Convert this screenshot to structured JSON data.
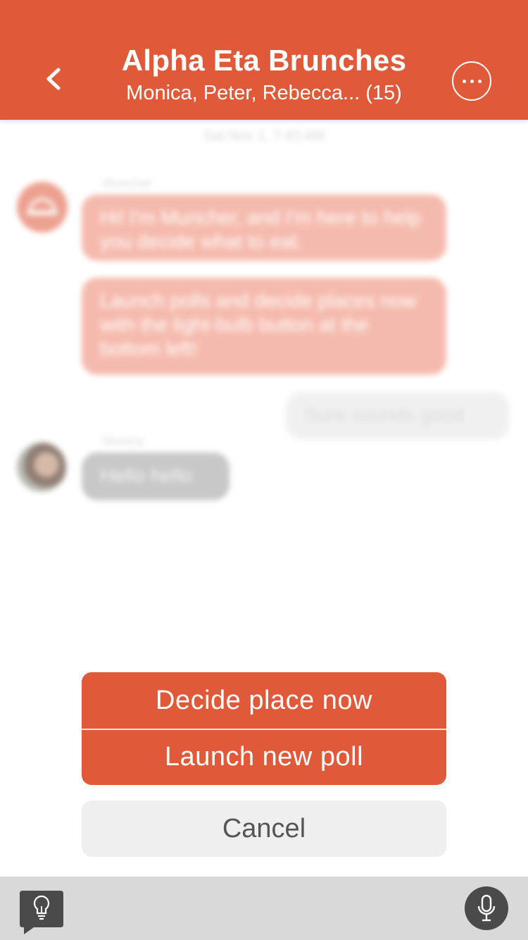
{
  "header": {
    "title": "Alpha Eta Brunches",
    "subtitle": "Monica, Peter, Rebecca... (15)",
    "back_icon": "chevron-left-icon",
    "more_icon": "more-options-icon",
    "color": "#e05a3a"
  },
  "chat": {
    "timestamp": "Sat Nov 1, 7:43 AM",
    "bot_sender": "Muncher",
    "bot_messages": [
      "Hi! I'm Muncher, and I'm here to help you decide what to eat.",
      "Launch polls and decide places now with the light-bulb button at the bottom left!"
    ],
    "my_message": "Sure sounds good",
    "user_sender": "Monica",
    "user_message": "Hello hello"
  },
  "action_sheet": {
    "decide_label": "Decide place now",
    "poll_label": "Launch new poll",
    "cancel_label": "Cancel"
  },
  "bottom_bar": {
    "idea_icon": "lightbulb-icon",
    "mic_icon": "microphone-icon"
  }
}
